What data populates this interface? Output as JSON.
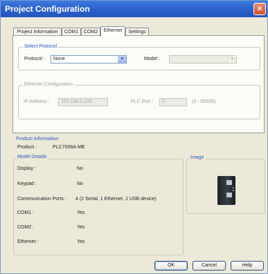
{
  "window": {
    "title": "Project Configuration",
    "close_glyph": "×"
  },
  "tabs": [
    {
      "label": "Project Information"
    },
    {
      "label": "COM1"
    },
    {
      "label": "COM2"
    },
    {
      "label": "Ethernet",
      "active": true
    },
    {
      "label": "Settings"
    }
  ],
  "select_protocol": {
    "legend": "Select Protocol",
    "protocol_label": "Protocol :",
    "protocol_value": "None",
    "model_label": "Model :",
    "model_value": ""
  },
  "ethernet_config": {
    "legend": "Ethernet Configuration",
    "ip_label": "IP Address :",
    "ip_value": "192.168.2.108",
    "port_label": "PLC Port :",
    "port_value": "0",
    "port_range": "(0 - 65535)"
  },
  "product": {
    "section_title": "Product Information",
    "product_label": "Product :",
    "product_value": "PLC7008A-ME",
    "model_details_title": "Model Details",
    "image_title": "Image",
    "details": [
      {
        "label": "Display :",
        "value": "No"
      },
      {
        "label": "Keypad :",
        "value": "No"
      },
      {
        "label": "Communication Ports :",
        "value": "4 (2 Serial, 1 Ethernet, 1 USB device)"
      },
      {
        "label": "COM1 :",
        "value": "Yes"
      },
      {
        "label": "COM2 :",
        "value": "Yes"
      },
      {
        "label": "Ethernet :",
        "value": "Yes"
      }
    ]
  },
  "buttons": {
    "ok": "OK",
    "cancel": "Cancel",
    "help": "Help"
  }
}
